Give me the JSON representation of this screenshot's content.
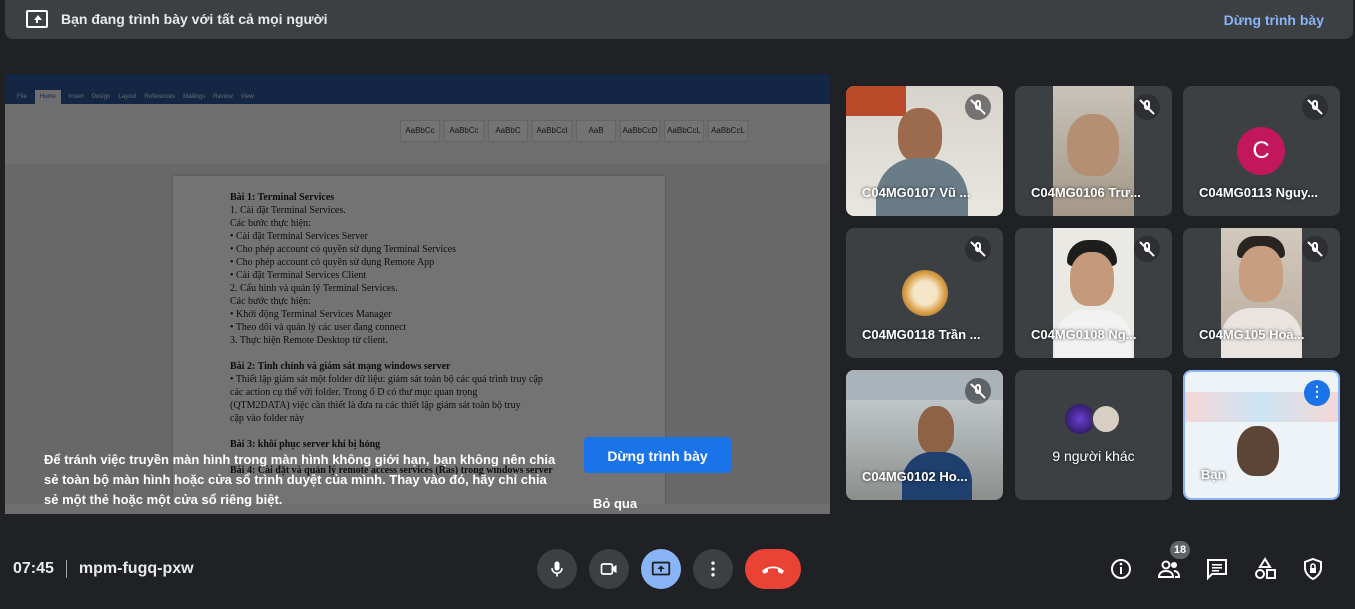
{
  "banner": {
    "message": "Bạn đang trình bày với tất cả mọi người",
    "stop_label": "Dừng trình bày"
  },
  "shared_screen": {
    "doc_lines": [
      "Bài 1: Terminal Services",
      "1.  Cài đặt Terminal Services.",
      "Các bước thực hiện:",
      "•  Cài đặt Terminal Services Server",
      "•  Cho phép account có quyền sử dụng Terminal Services",
      "•  Cho phép account có quyền sử dụng Remote App",
      "•  Cài đặt Terminal Services Client",
      "2. Cấu hình và quản lý Terminal Services.",
      "Các bước thực hiện:",
      "•  Khởi động Terminal Services Manager",
      "•  Theo dõi và quản lý các user đang connect",
      "3. Thực hiện Remote Desktop từ client.",
      "",
      "Bài 2: Tinh chỉnh và giám sát mạng  windows server",
      "•  Thiết lập giám sát một folder dữ liệu: giám sát toàn bộ các quá trình truy cập",
      "    các  action  cụ  thể  với  folder.  Trong  ổ  D  có  thư  mục  quan  trọng",
      "    (QTM2DATA) việc cần thiết là đưa ra các thiết lập giám sát toàn bộ truy",
      "    cập vào folder này",
      "",
      "Bài 3: khôi phục server khi bị hỏng",
      "",
      "Bài 4: Cài đặt và quản lý remote access services (Ras) trong windows server"
    ],
    "ribbon_tabs": [
      "File",
      "Home",
      "Insert",
      "Design",
      "Layout",
      "References",
      "Mailings",
      "Review",
      "View"
    ],
    "ribbon_styles": [
      "AaBbCc",
      "AaBbCc",
      "AaBbC",
      "AaBbCcl",
      "AaB",
      "AaBbCcD",
      "AaBbCcL",
      "AaBbCcL"
    ]
  },
  "notice": {
    "text": "Để tránh việc truyền màn hình trong màn hình không giới hạn, bạn không nên chia sẻ toàn bộ màn hình hoặc cửa sổ trình duyệt của mình. Thay vào đó, hãy chỉ chia sẻ một thẻ hoặc một cửa sổ riêng biệt.",
    "stop_button": "Dừng trình bày",
    "dismiss_label": "Bỏ qua"
  },
  "participants": [
    {
      "name": "C04MG0107 Vũ ...",
      "muted": true
    },
    {
      "name": "C04MG0106 Trư...",
      "muted": true
    },
    {
      "name": "C04MG0113 Nguy...",
      "muted": true,
      "avatar_letter": "C"
    },
    {
      "name": "C04MG0118 Trần ...",
      "muted": true
    },
    {
      "name": "C04MG0108 Ng...",
      "muted": true
    },
    {
      "name": "C04MG105 Hoà...",
      "muted": true
    },
    {
      "name": "C04MG0102 Ho...",
      "muted": true
    },
    {
      "name": "9 người khác"
    },
    {
      "name": "Bạn"
    }
  ],
  "meeting": {
    "time": "07:45",
    "code": "mpm-fugq-pxw",
    "participant_count": "18"
  },
  "colors": {
    "background": "#202124",
    "tile": "#3c4043",
    "accent_blue": "#8ab4f8",
    "button_blue": "#1a73e8",
    "end_call_red": "#ea4335",
    "avatar_c": "#c2185b"
  },
  "icons": {
    "mic": "mic-icon",
    "camera": "camera-icon",
    "present": "present-icon",
    "more": "more-vert-icon",
    "end_call": "hang-up-icon",
    "info": "info-icon",
    "people": "people-icon",
    "chat": "chat-icon",
    "activities": "activities-icon",
    "host_controls": "lock-shield-icon"
  }
}
